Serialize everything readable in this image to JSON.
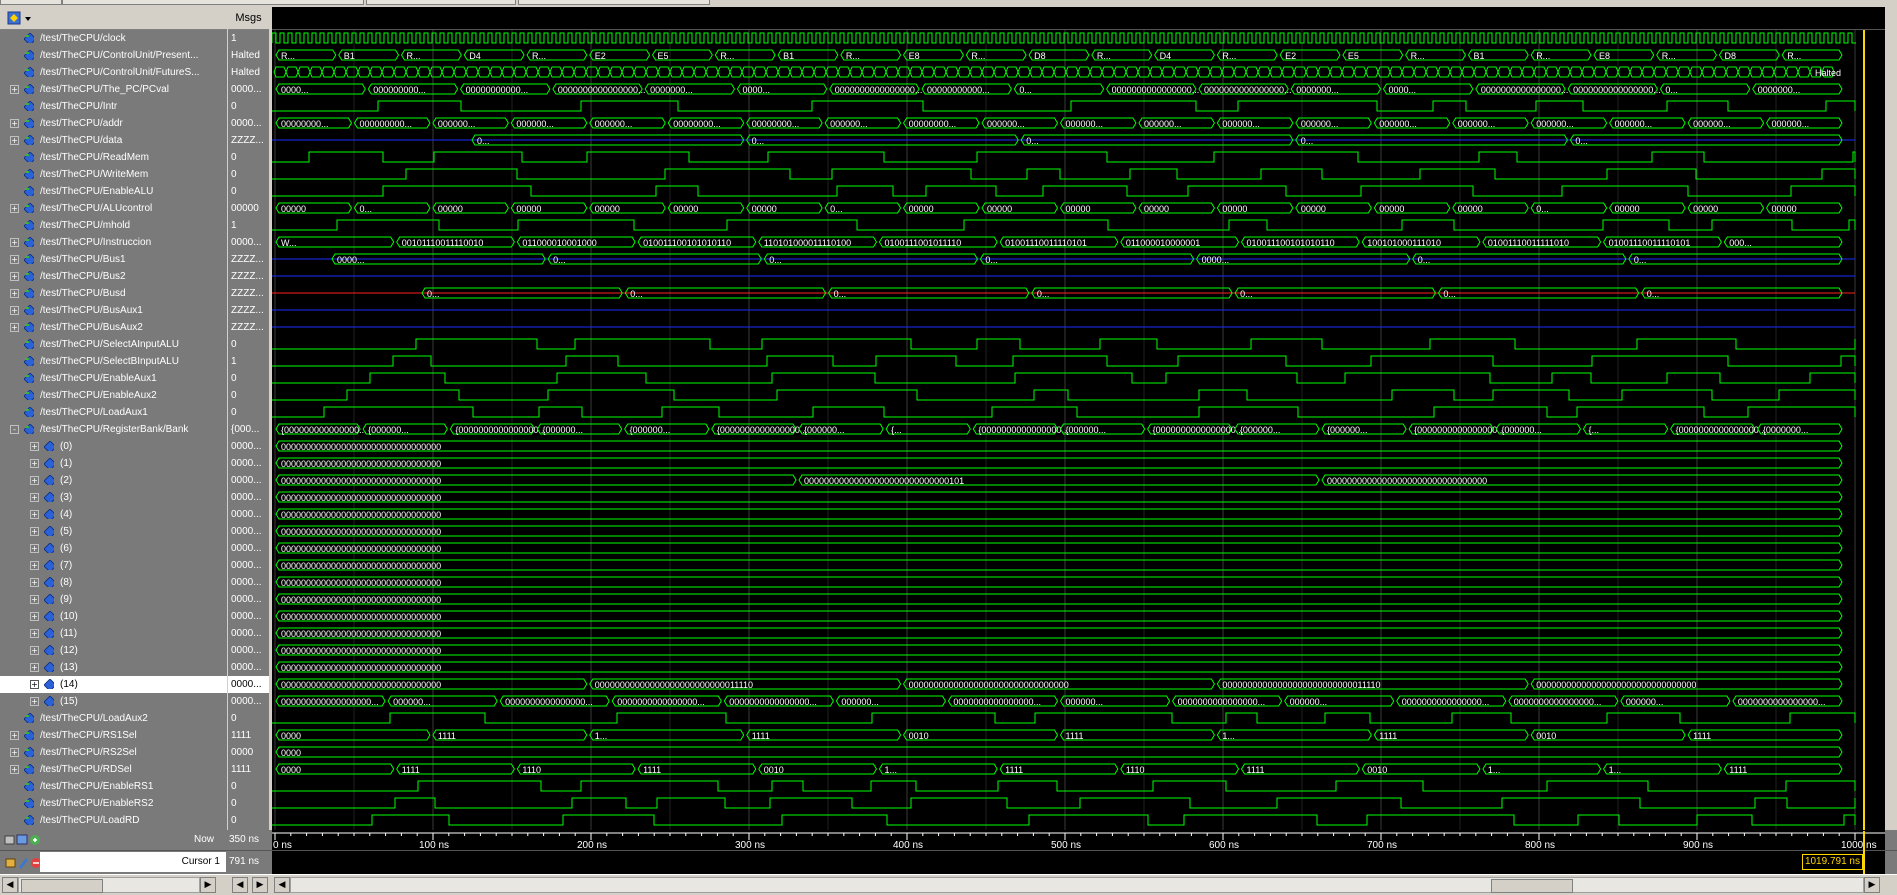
{
  "header": {
    "msgs_label": "Msgs"
  },
  "signals": [
    {
      "name": "/test/TheCPU/clock",
      "value": "1",
      "expander": "",
      "kind": "clock"
    },
    {
      "name": "/test/TheCPU/ControlUnit/Present...",
      "value": "Halted",
      "expander": "",
      "kind": "bus"
    },
    {
      "name": "/test/TheCPU/ControlUnit/FutureS...",
      "value": "Halted",
      "expander": "",
      "kind": "bus"
    },
    {
      "name": "/test/TheCPU/The_PC/PCval",
      "value": "0000...",
      "expander": "+",
      "kind": "bus"
    },
    {
      "name": "/test/TheCPU/Intr",
      "value": "0",
      "expander": "",
      "kind": "bit"
    },
    {
      "name": "/test/TheCPU/addr",
      "value": "0000...",
      "expander": "+",
      "kind": "bus"
    },
    {
      "name": "/test/TheCPU/data",
      "value": "ZZZZ...",
      "expander": "+",
      "kind": "zbus"
    },
    {
      "name": "/test/TheCPU/ReadMem",
      "value": "0",
      "expander": "",
      "kind": "bit"
    },
    {
      "name": "/test/TheCPU/WriteMem",
      "value": "0",
      "expander": "",
      "kind": "bit"
    },
    {
      "name": "/test/TheCPU/EnableALU",
      "value": "0",
      "expander": "",
      "kind": "bit"
    },
    {
      "name": "/test/TheCPU/ALUcontrol",
      "value": "00000",
      "expander": "+",
      "kind": "bus"
    },
    {
      "name": "/test/TheCPU/mhold",
      "value": "1",
      "expander": "",
      "kind": "bit"
    },
    {
      "name": "/test/TheCPU/Instruccion",
      "value": "0000...",
      "expander": "+",
      "kind": "bus"
    },
    {
      "name": "/test/TheCPU/Bus1",
      "value": "ZZZZ...",
      "expander": "+",
      "kind": "zbus"
    },
    {
      "name": "/test/TheCPU/Bus2",
      "value": "ZZZZ...",
      "expander": "+",
      "kind": "zbus"
    },
    {
      "name": "/test/TheCPU/Busd",
      "value": "ZZZZ...",
      "expander": "+",
      "kind": "redbus"
    },
    {
      "name": "/test/TheCPU/BusAux1",
      "value": "ZZZZ...",
      "expander": "+",
      "kind": "zbus"
    },
    {
      "name": "/test/TheCPU/BusAux2",
      "value": "ZZZZ...",
      "expander": "+",
      "kind": "zbus"
    },
    {
      "name": "/test/TheCPU/SelectAInputALU",
      "value": "0",
      "expander": "",
      "kind": "bit"
    },
    {
      "name": "/test/TheCPU/SelectBInputALU",
      "value": "1",
      "expander": "",
      "kind": "bit"
    },
    {
      "name": "/test/TheCPU/EnableAux1",
      "value": "0",
      "expander": "",
      "kind": "bit"
    },
    {
      "name": "/test/TheCPU/EnableAux2",
      "value": "0",
      "expander": "",
      "kind": "bit"
    },
    {
      "name": "/test/TheCPU/LoadAux1",
      "value": "0",
      "expander": "",
      "kind": "bit"
    },
    {
      "name": "/test/TheCPU/RegisterBank/Bank",
      "value": "{000...",
      "expander": "-",
      "kind": "bus"
    },
    {
      "name": "(0)",
      "value": "0000...",
      "expander": "+",
      "kind": "reg",
      "child": true
    },
    {
      "name": "(1)",
      "value": "0000...",
      "expander": "+",
      "kind": "reg",
      "child": true
    },
    {
      "name": "(2)",
      "value": "0000...",
      "expander": "+",
      "kind": "reg",
      "child": true
    },
    {
      "name": "(3)",
      "value": "0000...",
      "expander": "+",
      "kind": "reg",
      "child": true
    },
    {
      "name": "(4)",
      "value": "0000...",
      "expander": "+",
      "kind": "reg",
      "child": true
    },
    {
      "name": "(5)",
      "value": "0000...",
      "expander": "+",
      "kind": "reg",
      "child": true
    },
    {
      "name": "(6)",
      "value": "0000...",
      "expander": "+",
      "kind": "reg",
      "child": true
    },
    {
      "name": "(7)",
      "value": "0000...",
      "expander": "+",
      "kind": "reg",
      "child": true
    },
    {
      "name": "(8)",
      "value": "0000...",
      "expander": "+",
      "kind": "reg",
      "child": true
    },
    {
      "name": "(9)",
      "value": "0000...",
      "expander": "+",
      "kind": "reg",
      "child": true
    },
    {
      "name": "(10)",
      "value": "0000...",
      "expander": "+",
      "kind": "reg",
      "child": true
    },
    {
      "name": "(11)",
      "value": "0000...",
      "expander": "+",
      "kind": "reg",
      "child": true
    },
    {
      "name": "(12)",
      "value": "0000...",
      "expander": "+",
      "kind": "reg",
      "child": true
    },
    {
      "name": "(13)",
      "value": "0000...",
      "expander": "+",
      "kind": "reg",
      "child": true
    },
    {
      "name": "(14)",
      "value": "0000...",
      "expander": "+",
      "kind": "reg",
      "child": true,
      "selected": true
    },
    {
      "name": "(15)",
      "value": "0000...",
      "expander": "+",
      "kind": "reg",
      "child": true
    },
    {
      "name": "/test/TheCPU/LoadAux2",
      "value": "0",
      "expander": "",
      "kind": "bit"
    },
    {
      "name": "/test/TheCPU/RS1Sel",
      "value": "1111",
      "expander": "+",
      "kind": "bus"
    },
    {
      "name": "/test/TheCPU/RS2Sel",
      "value": "0000",
      "expander": "+",
      "kind": "bus"
    },
    {
      "name": "/test/TheCPU/RDSel",
      "value": "1111",
      "expander": "+",
      "kind": "bus"
    },
    {
      "name": "/test/TheCPU/EnableRS1",
      "value": "0",
      "expander": "",
      "kind": "bit"
    },
    {
      "name": "/test/TheCPU/EnableRS2",
      "value": "0",
      "expander": "",
      "kind": "bit"
    },
    {
      "name": "/test/TheCPU/LoadRD",
      "value": "0",
      "expander": "",
      "kind": "bit"
    }
  ],
  "wave_labels": {
    "present": [
      "R...",
      "B1",
      "R...",
      "D4",
      "R...",
      "E2",
      "E5",
      "R...",
      "B1",
      "R...",
      "E8",
      "R...",
      "D8",
      "R...",
      "D4",
      "R...",
      "E2",
      "E5",
      "R...",
      "B1",
      "R...",
      "E8",
      "R...",
      "D8",
      "R..."
    ],
    "futures_end": "Halted",
    "pcval": [
      "0000...",
      "000000000...",
      "00000000000...",
      "0000000000000000...",
      "0000000...",
      "0000...",
      "0000000000000000...",
      "00000000000...",
      "0...",
      "0000000000000000...",
      "0000000000000000...",
      "0000000...",
      "0000...",
      "0000000000000000...",
      "0000000000000000...",
      "0...",
      "0000000..."
    ],
    "addr": [
      "00000000...",
      "000000000...",
      "000000...",
      "000000...",
      "000000...",
      "00000000...",
      "00000000...",
      "000000...",
      "00000000...",
      "000000...",
      "000000...",
      "000000...",
      "000000...",
      "000000...",
      "000000...",
      "000000...",
      "000000...",
      "000000...",
      "000000...",
      "000000..."
    ],
    "data": [
      "0...",
      "0...",
      "0...",
      "0...",
      "0..."
    ],
    "alucontrol": [
      "00000",
      "0...",
      "00000",
      "00000",
      "00000",
      "00000",
      "00000",
      "0...",
      "00000",
      "00000",
      "00000",
      "00000",
      "00000",
      "00000",
      "00000",
      "00000",
      "0...",
      "00000",
      "00000",
      "00000"
    ],
    "instruccion": [
      "W...",
      "00101110011110010",
      "011000010001000",
      "010011100101010110",
      "110101000011110100",
      "0100111001011110",
      "01001110011110101",
      "011000010000001",
      "010011100101010110",
      "100101000111010",
      "01001110011111010",
      "01001110011110101",
      "000..."
    ],
    "bus1": [
      "0000...",
      "0...",
      "0...",
      "0...",
      "0000...",
      "0...",
      "0..."
    ],
    "busd": [
      "0...",
      "0...",
      "0...",
      "0...",
      "0...",
      "0...",
      "0..."
    ],
    "bank_top": [
      "{000000000000000...",
      "{000000...",
      "{0000000000000000...",
      "{000000...",
      "{000000...",
      "{0000000000000000...",
      "{000000...",
      "{...",
      "{0000000000000000...",
      "{000000...",
      "{0000000000000000...",
      "{000000...",
      "{000000...",
      "{0000000000000000...",
      "{000000...",
      "{...",
      "{0000000000000000...",
      "{0000000..."
    ],
    "reg_zero": "00000000000000000000000000000000",
    "reg2_a": "00000000000000000000000000000101",
    "reg2_b": "00000000000000000000000000000000",
    "reg14_a": "00000000000000000000000000000000",
    "reg14_b": "00000000000000000000000000011110",
    "reg14_c": "00000000000000000000000000000000",
    "reg14_d": "00000000000000000000000000011110",
    "reg14_e": "00000000000000000000000000000000",
    "reg15": [
      "000000000000000000...",
      "000000...",
      "0000000000000000...",
      "0000000000000000...",
      "0000000000000000...",
      "000000...",
      "0000000000000000...",
      "000000...",
      "0000000000000000...",
      "000000...",
      "0000000000000000...",
      "0000000000000000...",
      "000000...",
      "0000000000000000..."
    ],
    "rs1sel": [
      "0000",
      "1111",
      "1...",
      "1111",
      "0010",
      "1111",
      "1...",
      "1111",
      "0010",
      "1111"
    ],
    "rs2sel": [
      "0000"
    ],
    "rdsel": [
      "0000",
      "1111",
      "1110",
      "1111",
      "0010",
      "1...",
      "1111",
      "1110",
      "1111",
      "0010",
      "1...",
      "1...",
      "1111"
    ]
  },
  "time_axis": {
    "ticks": [
      "0 ns",
      "100 ns",
      "200 ns",
      "300 ns",
      "400 ns",
      "500 ns",
      "600 ns",
      "700 ns",
      "800 ns",
      "900 ns",
      "1000 ns"
    ],
    "now_label": "Now",
    "now_value": "350 ns",
    "cursor_label": "Cursor 1",
    "cursor_value": "791 ns",
    "cursor_readout": "1019.791 ns"
  },
  "colors": {
    "wave_green": "#00ff00",
    "wave_blue": "#1d2cff",
    "wave_red": "#ff2020",
    "cursor_yellow": "#ffd700",
    "grid": "#3c3c3c"
  }
}
